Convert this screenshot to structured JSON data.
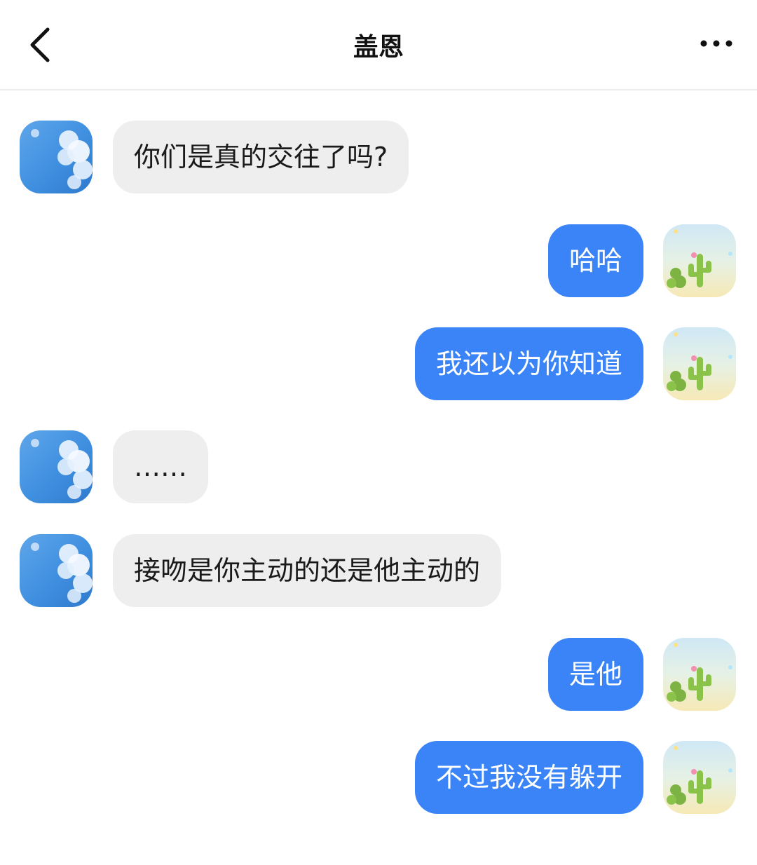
{
  "header": {
    "title": "盖恩",
    "back_icon": "chevron-left-icon",
    "more_icon": "more-horizontal-icon"
  },
  "theme": {
    "incoming_bubble": "#eeeeee",
    "outgoing_bubble": "#3a84f8",
    "incoming_text": "#1a1a1a",
    "outgoing_text": "#ffffff"
  },
  "avatars": {
    "contact": "sky-clouds-avatar",
    "self": "cactus-avatar"
  },
  "messages": [
    {
      "from": "contact",
      "text": "你们是真的交往了吗?"
    },
    {
      "from": "self",
      "text": "哈哈"
    },
    {
      "from": "self",
      "text": "我还以为你知道"
    },
    {
      "from": "contact",
      "text": "……"
    },
    {
      "from": "contact",
      "text": "接吻是你主动的还是他主动的"
    },
    {
      "from": "self",
      "text": "是他"
    },
    {
      "from": "self",
      "text": "不过我没有躲开"
    }
  ]
}
